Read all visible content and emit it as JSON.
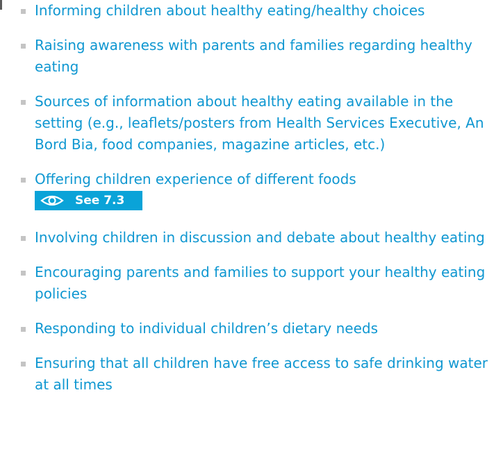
{
  "colors": {
    "text": "#0f97d1",
    "bullet": "#c4c4c4",
    "badge_bg": "#0aa3d8",
    "badge_text": "#ffffff"
  },
  "items": [
    {
      "text": "Informing children about healthy eating/healthy choices"
    },
    {
      "text": "Raising awareness with parents and families regarding healthy eating"
    },
    {
      "text": "Sources of information about healthy eating available in the setting (e.g., leaflets/posters from Health Services Executive, An Bord Bia, food companies, magazine articles, etc.)"
    },
    {
      "text": "Offering children experience of different foods",
      "badge": {
        "icon": "eye-icon",
        "label": "See 7.3"
      }
    },
    {
      "text": "Involving children in discussion and debate about healthy eating"
    },
    {
      "text": "Encouraging parents and families to support your healthy eating policies"
    },
    {
      "text": "Responding to individual children’s dietary needs"
    },
    {
      "text": "Ensuring that all children have free access to safe drinking water at all times"
    }
  ]
}
